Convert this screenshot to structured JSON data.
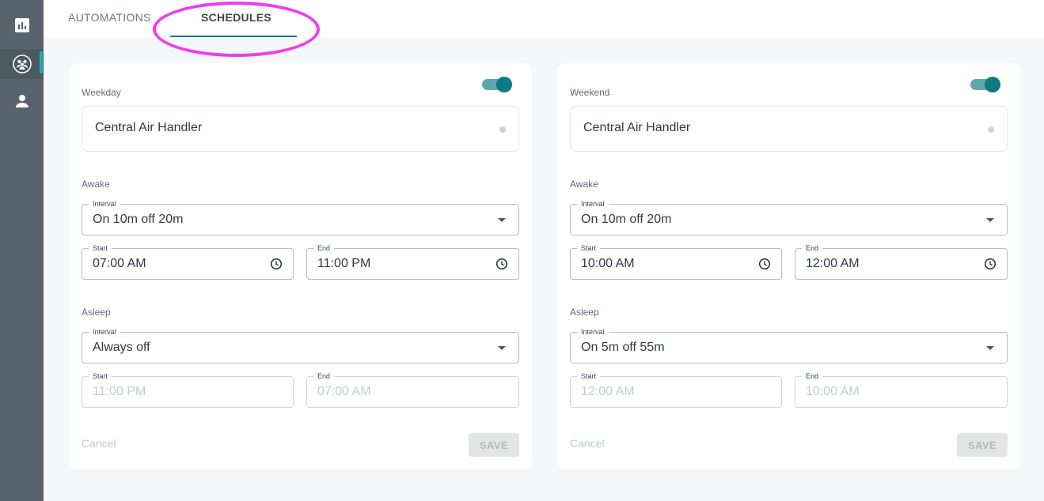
{
  "sidebar": {
    "items": [
      {
        "icon": "bar-chart-icon"
      },
      {
        "icon": "group-icon",
        "active": true
      },
      {
        "icon": "person-icon"
      }
    ]
  },
  "tabs": {
    "automations": "AUTOMATIONS",
    "schedules": "SCHEDULES",
    "active": "schedules"
  },
  "accent_color": "#0e7a82",
  "schedules": [
    {
      "title": "Weekday",
      "enabled": true,
      "device": "Central Air Handler",
      "awake": {
        "label": "Awake",
        "interval_label": "Interval",
        "interval": "On 10m off 20m",
        "start_label": "Start",
        "start": "07:00 AM",
        "end_label": "End",
        "end": "11:00 PM"
      },
      "asleep": {
        "label": "Asleep",
        "interval_label": "Interval",
        "interval": "Always off",
        "start_label": "Start",
        "start": "11:00 PM",
        "end_label": "End",
        "end": "07:00 AM"
      },
      "cancel": "Cancel",
      "save": "SAVE"
    },
    {
      "title": "Weekend",
      "enabled": true,
      "device": "Central Air Handler",
      "awake": {
        "label": "Awake",
        "interval_label": "Interval",
        "interval": "On 10m off 20m",
        "start_label": "Start",
        "start": "10:00 AM",
        "end_label": "End",
        "end": "12:00 AM"
      },
      "asleep": {
        "label": "Asleep",
        "interval_label": "Interval",
        "interval": "On 5m off 55m",
        "start_label": "Start",
        "start": "12:00 AM",
        "end_label": "End",
        "end": "10:00 AM"
      },
      "cancel": "Cancel",
      "save": "SAVE"
    }
  ]
}
